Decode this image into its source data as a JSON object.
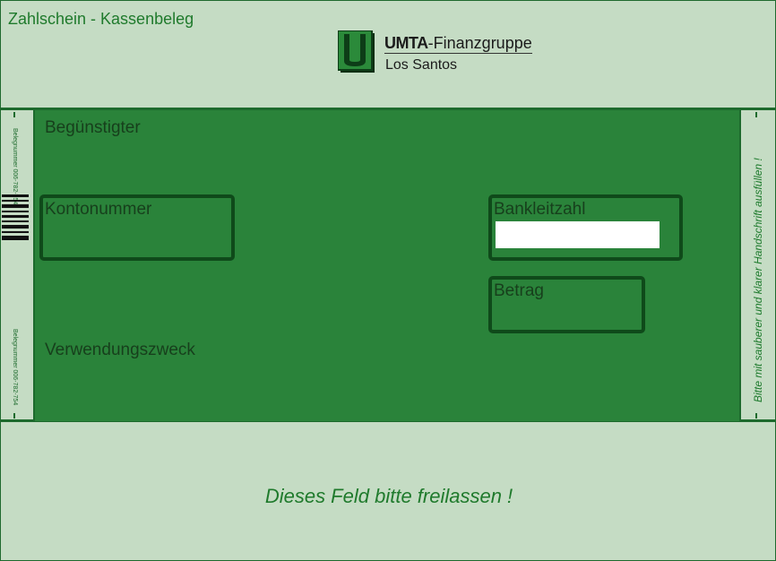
{
  "header": {
    "title": "Zahlschein - Kassenbeleg",
    "logo": {
      "letter": "U",
      "brand": "UMTA",
      "brand_suffix": "-Finanzgruppe",
      "city": "Los Santos"
    }
  },
  "form": {
    "beneficiary_label": "Begünstigter",
    "account_label": "Kontonummer",
    "bank_code_label": "Bankleitzahl",
    "bank_code_value": "",
    "amount_label": "Betrag",
    "purpose_label": "Verwendungszweck"
  },
  "side": {
    "left_top": "Belegnummer 006-782-754",
    "left_bottom": "Belegnummer 006-782-754",
    "right_note": "Bitte mit sauberer und klarer Handschrift ausfüllen !"
  },
  "footer": {
    "note": "Dieses Feld bitte freilassen !"
  },
  "colors": {
    "background": "#c5dcc4",
    "form_green": "#2a833a",
    "border_dark": "#0f4a1a",
    "text_green": "#1f7a2c"
  }
}
